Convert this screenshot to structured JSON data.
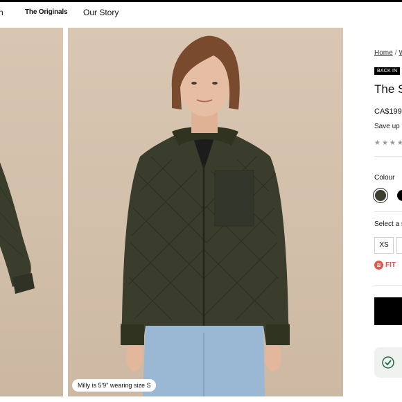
{
  "nav": {
    "cut_item": "n",
    "originals": "The Originals",
    "story": "Our Story"
  },
  "gallery": {
    "caption": "Milly is 5'9\" wearing size S",
    "jacket_color": "#3a3d2c"
  },
  "product": {
    "breadcrumb_home": "Home",
    "breadcrumb_sep": "/",
    "breadcrumb_next": "W",
    "badge": "BACK IN",
    "title": "The S",
    "price": "CA$199.",
    "save": "Save up t",
    "rating_stars": "★★★★",
    "colour_label": "Colour",
    "colours": [
      {
        "name": "olive",
        "hex": "#3b3e30",
        "selected": true
      },
      {
        "name": "black",
        "hex": "#000000",
        "selected": false
      }
    ],
    "size_label": "Select a s",
    "sizes": [
      "XS",
      ""
    ],
    "fit_label": "FIT",
    "fit_icon": "fit-icon"
  }
}
